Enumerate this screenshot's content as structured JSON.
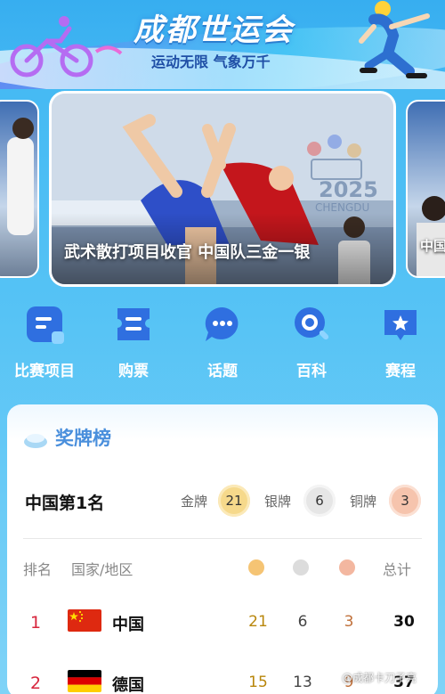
{
  "banner": {
    "title": "成都世运会",
    "slogan": "运动无限 气象万千"
  },
  "carousel": {
    "main_caption": "武术散打项目收官 中国队三金一银",
    "right_peek_caption": "中国",
    "logo_year": "2025",
    "logo_city": "CHENGDU"
  },
  "quick_nav": [
    {
      "label": "比赛项目",
      "icon": "schedule-list-icon"
    },
    {
      "label": "购票",
      "icon": "ticket-icon"
    },
    {
      "label": "话题",
      "icon": "chat-bubble-icon"
    },
    {
      "label": "百科",
      "icon": "search-encyclopedia-icon"
    },
    {
      "label": "赛程",
      "icon": "star-calendar-icon"
    }
  ],
  "medal_board": {
    "title": "奖牌榜",
    "summary": {
      "rank_text": "中国第1名",
      "gold_label": "金牌",
      "gold": "21",
      "silver_label": "银牌",
      "silver": "6",
      "bronze_label": "铜牌",
      "bronze": "3"
    },
    "columns": {
      "rank": "排名",
      "country": "国家/地区",
      "total": "总计"
    },
    "rows": [
      {
        "rank": "1",
        "country": "中国",
        "gold": "21",
        "silver": "6",
        "bronze": "3",
        "total": "30"
      },
      {
        "rank": "2",
        "country": "德国",
        "gold": "15",
        "silver": "13",
        "bronze": "9",
        "total": "37"
      }
    ]
  },
  "watermark": "@成都卡刀子亮",
  "colors": {
    "accent_blue": "#4a8fdc",
    "gold": "#f2c86b",
    "silver": "#d9d9d9",
    "bronze": "#f3b79a",
    "rank_red": "#d7263d"
  }
}
